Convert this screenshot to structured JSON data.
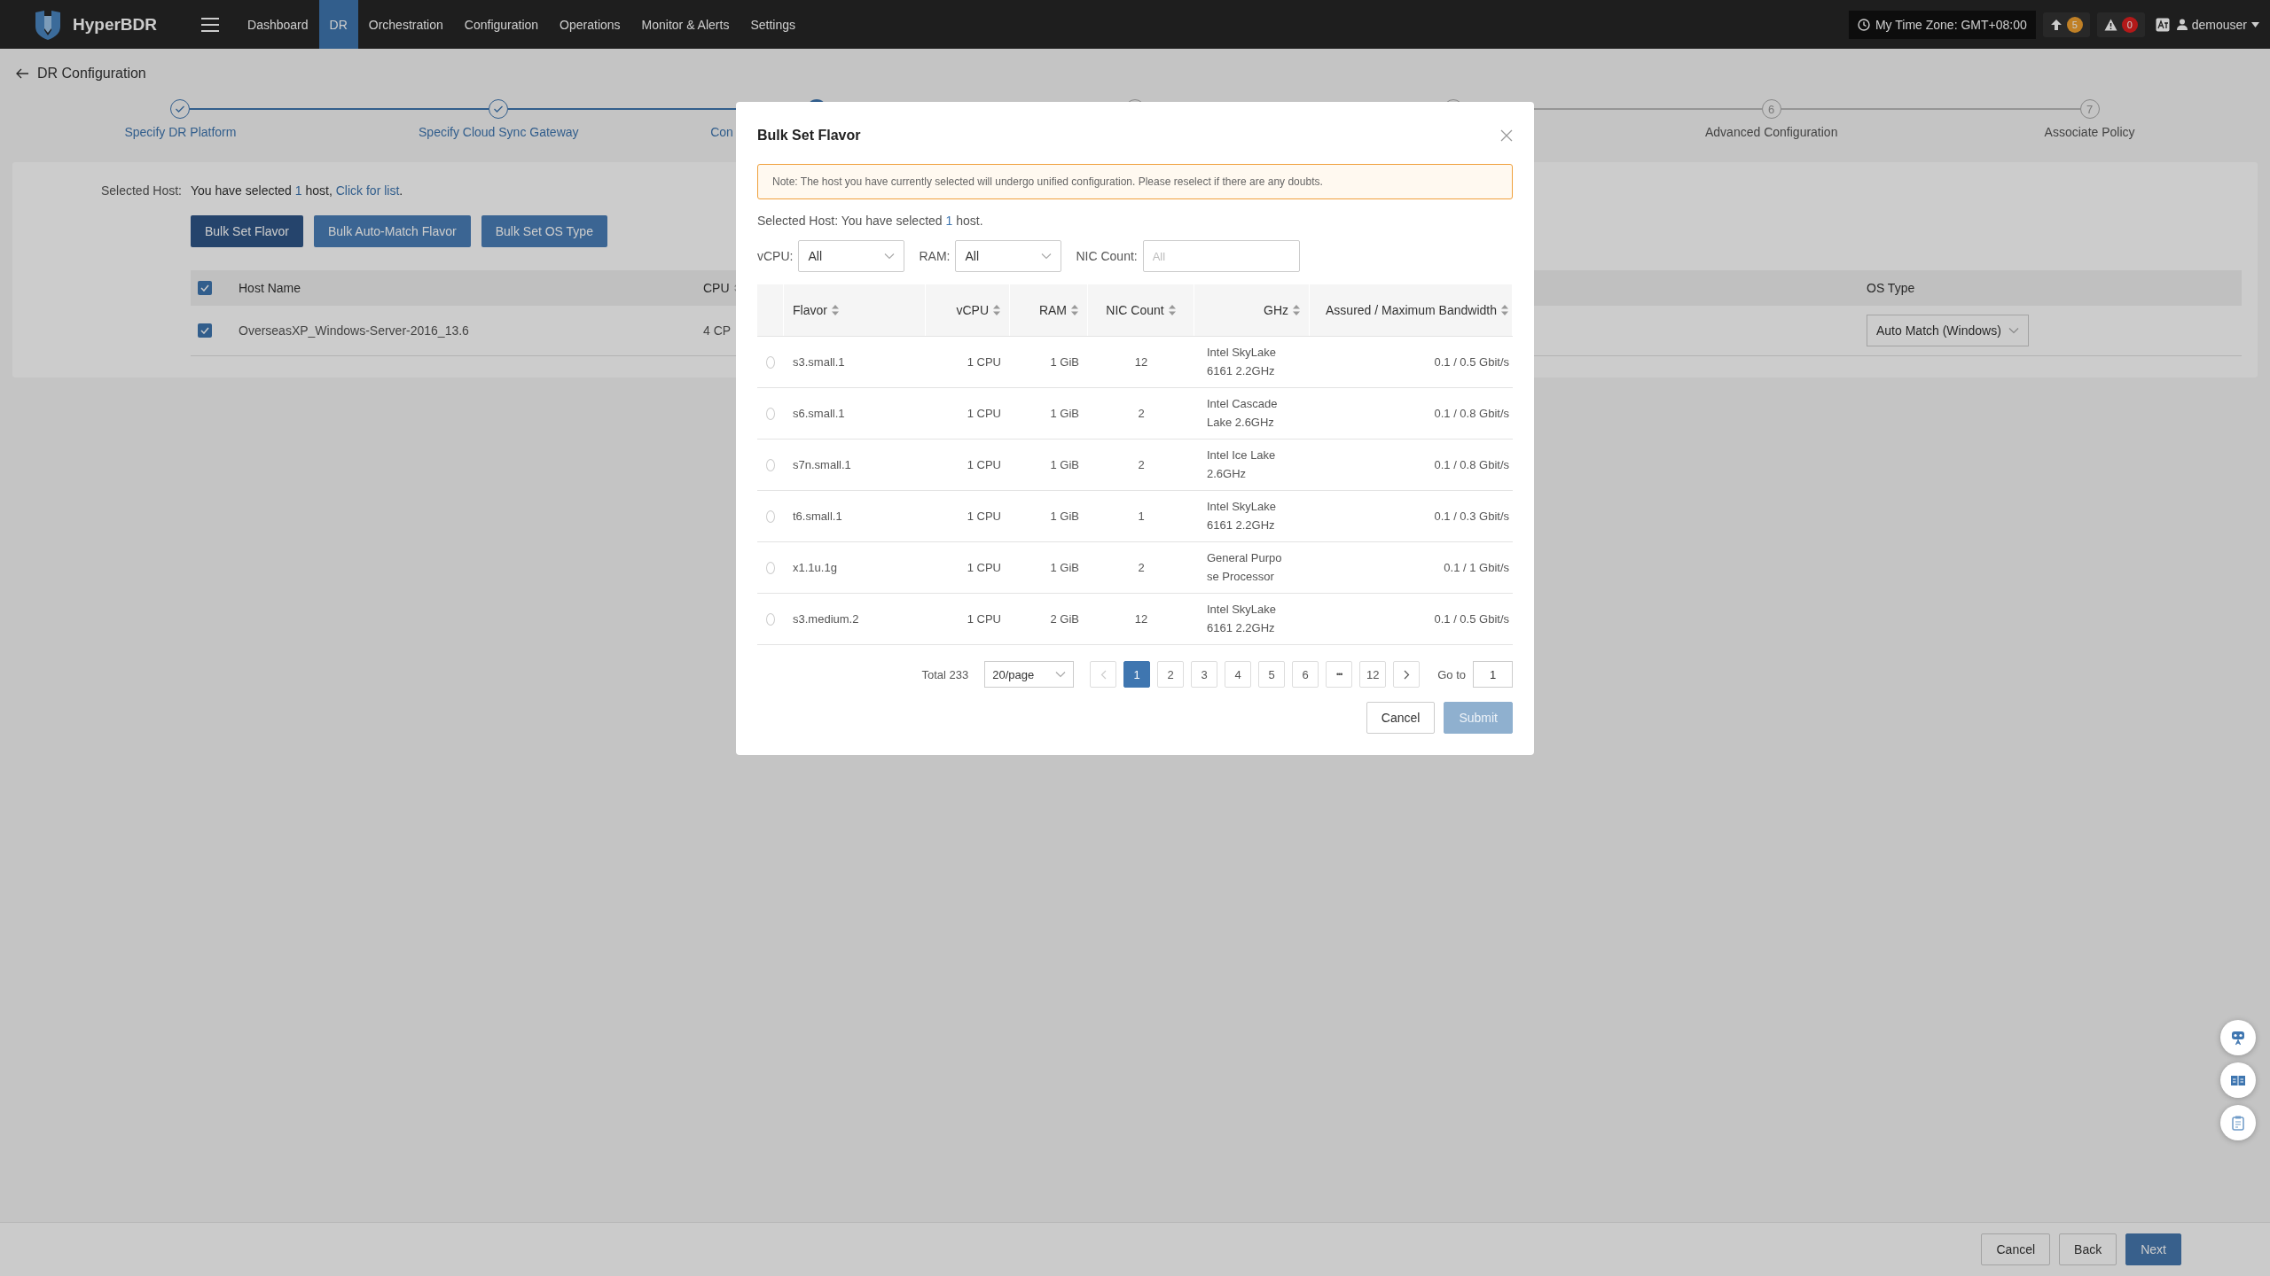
{
  "top_bar": {
    "brand": "HyperBDR",
    "nav": [
      {
        "label": "Dashboard",
        "selected": false
      },
      {
        "label": "DR",
        "selected": true
      },
      {
        "label": "Orchestration",
        "selected": false
      },
      {
        "label": "Configuration",
        "selected": false
      },
      {
        "label": "Operations",
        "selected": false
      },
      {
        "label": "Monitor & Alerts",
        "selected": false
      },
      {
        "label": "Settings",
        "selected": false
      }
    ],
    "time_zone": "My Time Zone: GMT+08:00",
    "upload_count": "5",
    "alert_count": "0",
    "user": "demouser"
  },
  "page_title": "DR Configuration",
  "steps": [
    {
      "done": true,
      "active": false,
      "label": "Specify DR Platform"
    },
    {
      "done": true,
      "active": false,
      "label": "Specify Cloud Sync Gateway"
    },
    {
      "done": false,
      "active": true,
      "label": "Con",
      "cut": true
    },
    {
      "done": false,
      "active": false
    },
    {
      "done": false,
      "active": false
    },
    {
      "done": false,
      "active": false,
      "number": "6",
      "label": "Advanced Configuration"
    },
    {
      "done": false,
      "active": false,
      "number": "7",
      "label": "Associate Policy"
    }
  ],
  "selection": {
    "label": "Selected Host:",
    "text": "You have selected ",
    "count": "1",
    "text_after": " host, ",
    "link": "Click for list",
    "end": "."
  },
  "bulk_buttons": [
    {
      "label": "Bulk Set Flavor",
      "selected": true
    },
    {
      "label": "Bulk Auto-Match Flavor",
      "selected": false
    },
    {
      "label": "Bulk Set OS Type",
      "selected": false
    }
  ],
  "host_table": {
    "all_checked": true,
    "columns": [
      "Host Name",
      "CPU",
      "OS Type"
    ],
    "rows": [
      {
        "checked": true,
        "host_name": "OverseasXP_Windows-Server-2016_13.6",
        "cpu": "4 CP",
        "os_type": "Auto Match (Windows)"
      }
    ]
  },
  "modal": {
    "title": "Bulk Set Flavor",
    "note": "Note: The host you have currently selected will undergo unified configuration. Please reselect if there are any doubts.",
    "selection": {
      "text": "Selected Host: You have selected ",
      "count": "1",
      "text_after": " host."
    },
    "filters": [
      {
        "kind": "select",
        "label": "vCPU:",
        "value": "All"
      },
      {
        "kind": "select",
        "label": "RAM:",
        "value": "All"
      },
      {
        "kind": "input",
        "label": "NIC Count:",
        "placeholder": "All"
      }
    ],
    "columns": [
      "Flavor",
      "vCPU",
      "RAM",
      "NIC Count",
      "GHz",
      "Assured / Maximum Bandwidth"
    ],
    "rows": [
      {
        "selected": false,
        "cells": [
          "s3.small.1",
          "1 CPU",
          "1 GiB",
          "12",
          "Intel SkyLake\n6161 2.2GHz",
          "0.1 / 0.5 Gbit/s"
        ]
      },
      {
        "selected": false,
        "cells": [
          "s6.small.1",
          "1 CPU",
          "1 GiB",
          "2",
          "Intel Cascade\nLake 2.6GHz",
          "0.1 / 0.8 Gbit/s"
        ]
      },
      {
        "selected": false,
        "cells": [
          "s7n.small.1",
          "1 CPU",
          "1 GiB",
          "2",
          "Intel Ice Lake\n2.6GHz",
          "0.1 / 0.8 Gbit/s"
        ]
      },
      {
        "selected": false,
        "cells": [
          "t6.small.1",
          "1 CPU",
          "1 GiB",
          "1",
          "Intel SkyLake\n6161 2.2GHz",
          "0.1 / 0.3 Gbit/s"
        ]
      },
      {
        "selected": false,
        "cells": [
          "x1.1u.1g",
          "1 CPU",
          "1 GiB",
          "2",
          "General Purpo\nse Processor",
          "0.1 / 1 Gbit/s"
        ]
      },
      {
        "selected": false,
        "cells": [
          "s3.medium.2",
          "1 CPU",
          "2 GiB",
          "12",
          "Intel SkyLake\n6161 2.2GHz",
          "0.1 / 0.5 Gbit/s"
        ]
      }
    ],
    "pagination": {
      "total": "Total 233",
      "page_size": "20/page",
      "prev_disabled": true,
      "next_disabled": false,
      "pages": [
        {
          "kind": "page",
          "label": "1",
          "selected": true
        },
        {
          "kind": "page",
          "label": "2",
          "selected": false
        },
        {
          "kind": "page",
          "label": "3",
          "selected": false
        },
        {
          "kind": "page",
          "label": "4",
          "selected": false
        },
        {
          "kind": "page",
          "label": "5",
          "selected": false
        },
        {
          "kind": "page",
          "label": "6",
          "selected": false
        },
        {
          "kind": "more",
          "label": "•••",
          "selected": false
        },
        {
          "kind": "page",
          "label": "12",
          "selected": false
        }
      ],
      "goto_label": "Go to",
      "goto_value": "1"
    },
    "buttons": [
      {
        "kind": "default",
        "label": "Cancel",
        "disabled": false
      },
      {
        "kind": "primary",
        "label": "Submit",
        "disabled": true
      }
    ]
  },
  "footer_buttons": [
    {
      "kind": "default",
      "label": "Cancel"
    },
    {
      "kind": "default",
      "label": "Back"
    },
    {
      "kind": "primary",
      "label": "Next"
    }
  ]
}
